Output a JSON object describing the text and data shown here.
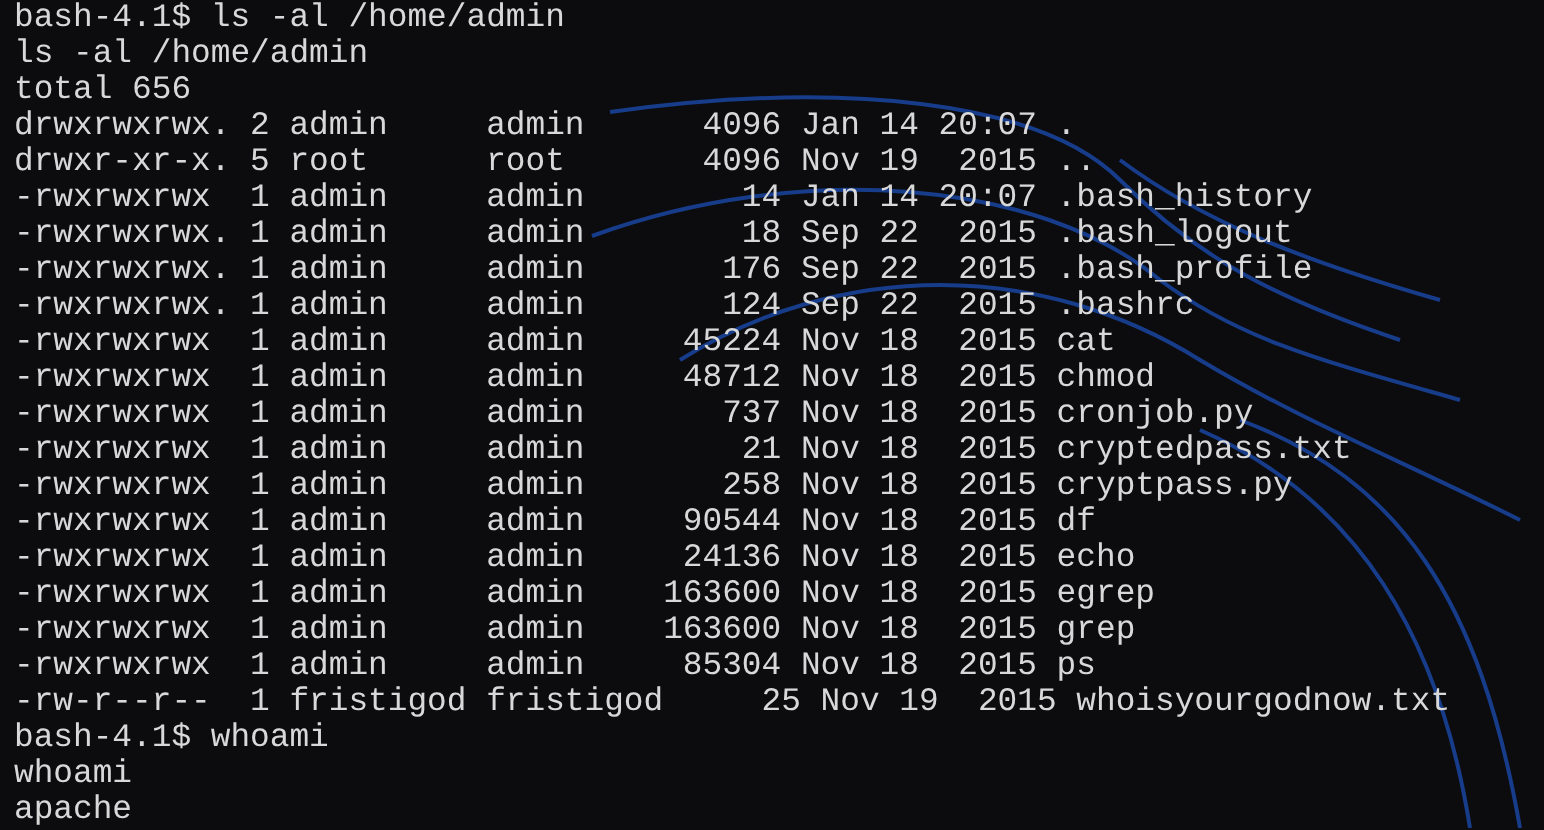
{
  "terminal": {
    "lines": [
      "bash-4.1$ ls -al /home/admin",
      "ls -al /home/admin",
      "total 656",
      "drwxrwxrwx. 2 admin     admin      4096 Jan 14 20:07 .",
      "drwxr-xr-x. 5 root      root       4096 Nov 19  2015 ..",
      "-rwxrwxrwx  1 admin     admin        14 Jan 14 20:07 .bash_history",
      "-rwxrwxrwx. 1 admin     admin        18 Sep 22  2015 .bash_logout",
      "-rwxrwxrwx. 1 admin     admin       176 Sep 22  2015 .bash_profile",
      "-rwxrwxrwx. 1 admin     admin       124 Sep 22  2015 .bashrc",
      "-rwxrwxrwx  1 admin     admin     45224 Nov 18  2015 cat",
      "-rwxrwxrwx  1 admin     admin     48712 Nov 18  2015 chmod",
      "-rwxrwxrwx  1 admin     admin       737 Nov 18  2015 cronjob.py",
      "-rwxrwxrwx  1 admin     admin        21 Nov 18  2015 cryptedpass.txt",
      "-rwxrwxrwx  1 admin     admin       258 Nov 18  2015 cryptpass.py",
      "-rwxrwxrwx  1 admin     admin     90544 Nov 18  2015 df",
      "-rwxrwxrwx  1 admin     admin     24136 Nov 18  2015 echo",
      "-rwxrwxrwx  1 admin     admin    163600 Nov 18  2015 egrep",
      "-rwxrwxrwx  1 admin     admin    163600 Nov 18  2015 grep",
      "-rwxrwxrwx  1 admin     admin     85304 Nov 18  2015 ps",
      "-rw-r--r--  1 fristigod fristigod     25 Nov 19  2015 whoisyourgodnow.txt",
      "bash-4.1$ whoami",
      "whoami",
      "apache"
    ]
  }
}
